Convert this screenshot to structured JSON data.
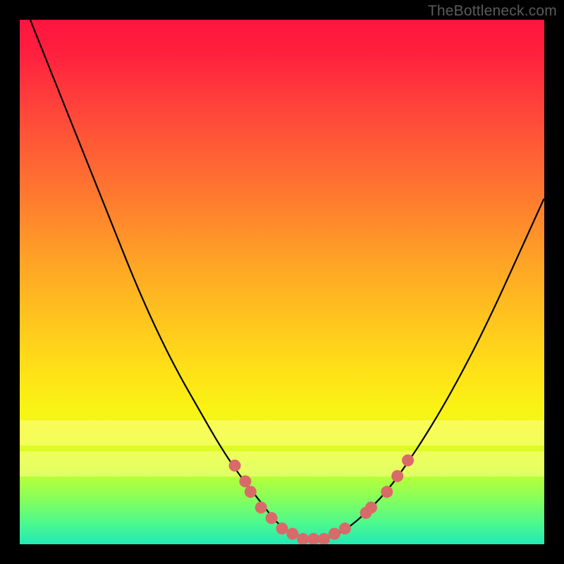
{
  "watermark": "TheBottleneck.com",
  "chart_data": {
    "type": "line",
    "title": "",
    "xlabel": "",
    "ylabel": "",
    "xlim": [
      0,
      100
    ],
    "ylim": [
      0,
      100
    ],
    "grid": false,
    "series": [
      {
        "name": "bottleneck-curve",
        "x": [
          2,
          6,
          10,
          14,
          18,
          22,
          26,
          30,
          34,
          38,
          42,
          46,
          49,
          52,
          55,
          58,
          61,
          65,
          70,
          75,
          80,
          85,
          90,
          95,
          100
        ],
        "y": [
          100,
          90,
          80,
          70,
          60,
          50,
          41,
          33,
          26,
          19,
          13,
          8,
          4,
          2,
          1,
          1,
          2,
          5,
          10,
          17,
          25,
          34,
          44,
          55,
          66
        ],
        "color": "#000000"
      }
    ],
    "markers": {
      "name": "highlight-dots",
      "color": "#d96a6a",
      "points": [
        {
          "x": 41,
          "y": 15
        },
        {
          "x": 43,
          "y": 12
        },
        {
          "x": 44,
          "y": 10
        },
        {
          "x": 46,
          "y": 7
        },
        {
          "x": 48,
          "y": 5
        },
        {
          "x": 50,
          "y": 3
        },
        {
          "x": 52,
          "y": 2
        },
        {
          "x": 54,
          "y": 1
        },
        {
          "x": 56,
          "y": 1
        },
        {
          "x": 58,
          "y": 1
        },
        {
          "x": 60,
          "y": 2
        },
        {
          "x": 62,
          "y": 3
        },
        {
          "x": 66,
          "y": 6
        },
        {
          "x": 67,
          "y": 7
        },
        {
          "x": 70,
          "y": 10
        },
        {
          "x": 72,
          "y": 13
        },
        {
          "x": 74,
          "y": 16
        }
      ]
    },
    "bands": [
      {
        "y0": 19,
        "y1": 24,
        "color": "rgba(255,255,140,0.55)"
      },
      {
        "y0": 13,
        "y1": 18,
        "color": "rgba(255,255,140,0.55)"
      }
    ],
    "gradient_stops": [
      {
        "pos": 0,
        "color": "#ff153f"
      },
      {
        "pos": 50,
        "color": "#ffc41e"
      },
      {
        "pos": 100,
        "color": "#22e9b6"
      }
    ]
  }
}
